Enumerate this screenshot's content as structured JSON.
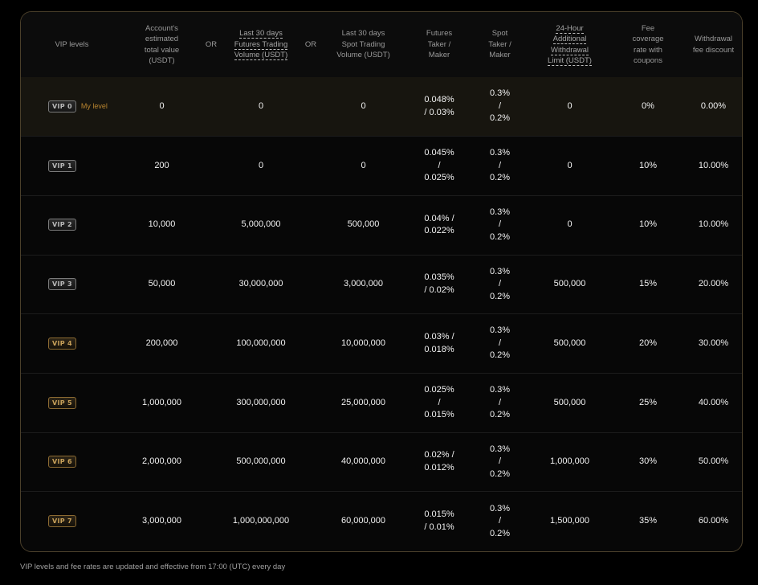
{
  "header": {
    "vip_levels": "VIP levels",
    "account_value": [
      "Account's",
      "estimated",
      "total value",
      "(USDT)"
    ],
    "or1": "OR",
    "futures_volume_line1": "Last 30 days",
    "futures_volume_line2": "Futures Trading",
    "futures_volume_line3": "Volume (USDT)",
    "or2": "OR",
    "spot_volume": [
      "Last 30 days",
      "Spot Trading",
      "Volume (USDT)"
    ],
    "futures_fee": [
      "Futures",
      "Taker /",
      "Maker"
    ],
    "spot_fee": [
      "Spot",
      "Taker /",
      "Maker"
    ],
    "withdraw_limit": [
      "24-Hour",
      "Additional",
      "Withdrawal",
      "Limit (USDT)"
    ],
    "coverage": [
      "Fee",
      "coverage",
      "rate with",
      "coupons"
    ],
    "withdraw_discount": [
      "Withdrawal",
      "fee discount"
    ]
  },
  "my_level_label": "My level",
  "rows": [
    {
      "badge": "VIP 0",
      "gold": false,
      "mine": true,
      "account": "0",
      "futures_vol": "0",
      "spot_vol": "0",
      "futures_fee": [
        "0.048%",
        "/ 0.03%"
      ],
      "spot_fee": [
        "0.3%",
        "/",
        "0.2%"
      ],
      "limit": "0",
      "coverage": "0%",
      "discount": "0.00%"
    },
    {
      "badge": "VIP 1",
      "gold": false,
      "mine": false,
      "account": "200",
      "futures_vol": "0",
      "spot_vol": "0",
      "futures_fee": [
        "0.045%",
        "/",
        "0.025%"
      ],
      "spot_fee": [
        "0.3%",
        "/",
        "0.2%"
      ],
      "limit": "0",
      "coverage": "10%",
      "discount": "10.00%"
    },
    {
      "badge": "VIP 2",
      "gold": false,
      "mine": false,
      "account": "10,000",
      "futures_vol": "5,000,000",
      "spot_vol": "500,000",
      "futures_fee": [
        "0.04% /",
        "0.022%"
      ],
      "spot_fee": [
        "0.3%",
        "/",
        "0.2%"
      ],
      "limit": "0",
      "coverage": "10%",
      "discount": "10.00%"
    },
    {
      "badge": "VIP 3",
      "gold": false,
      "mine": false,
      "account": "50,000",
      "futures_vol": "30,000,000",
      "spot_vol": "3,000,000",
      "futures_fee": [
        "0.035%",
        "/ 0.02%"
      ],
      "spot_fee": [
        "0.3%",
        "/",
        "0.2%"
      ],
      "limit": "500,000",
      "coverage": "15%",
      "discount": "20.00%"
    },
    {
      "badge": "VIP 4",
      "gold": true,
      "mine": false,
      "account": "200,000",
      "futures_vol": "100,000,000",
      "spot_vol": "10,000,000",
      "futures_fee": [
        "0.03% /",
        "0.018%"
      ],
      "spot_fee": [
        "0.3%",
        "/",
        "0.2%"
      ],
      "limit": "500,000",
      "coverage": "20%",
      "discount": "30.00%"
    },
    {
      "badge": "VIP 5",
      "gold": true,
      "mine": false,
      "account": "1,000,000",
      "futures_vol": "300,000,000",
      "spot_vol": "25,000,000",
      "futures_fee": [
        "0.025%",
        "/",
        "0.015%"
      ],
      "spot_fee": [
        "0.3%",
        "/",
        "0.2%"
      ],
      "limit": "500,000",
      "coverage": "25%",
      "discount": "40.00%"
    },
    {
      "badge": "VIP 6",
      "gold": true,
      "mine": false,
      "account": "2,000,000",
      "futures_vol": "500,000,000",
      "spot_vol": "40,000,000",
      "futures_fee": [
        "0.02% /",
        "0.012%"
      ],
      "spot_fee": [
        "0.3%",
        "/",
        "0.2%"
      ],
      "limit": "1,000,000",
      "coverage": "30%",
      "discount": "50.00%"
    },
    {
      "badge": "VIP 7",
      "gold": true,
      "mine": false,
      "account": "3,000,000",
      "futures_vol": "1,000,000,000",
      "spot_vol": "60,000,000",
      "futures_fee": [
        "0.015%",
        "/ 0.01%"
      ],
      "spot_fee": [
        "0.3%",
        "/",
        "0.2%"
      ],
      "limit": "1,500,000",
      "coverage": "35%",
      "discount": "60.00%"
    }
  ],
  "footer_note": "VIP levels and fee rates are updated and effective from 17:00 (UTC) every day"
}
